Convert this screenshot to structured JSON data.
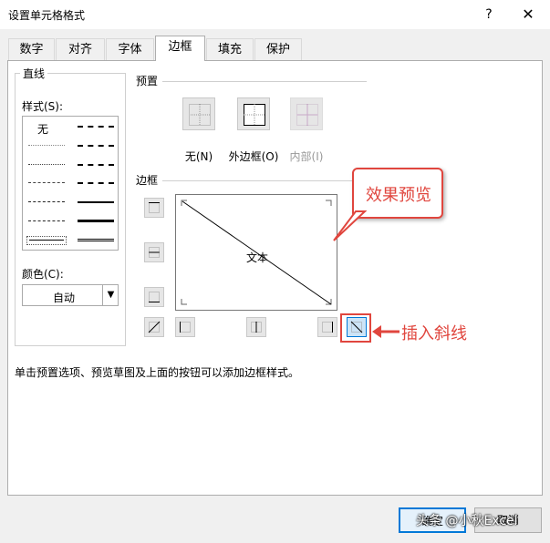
{
  "window": {
    "title": "设置单元格格式",
    "help": "?",
    "close": "✕"
  },
  "tabs": [
    {
      "label": "数字"
    },
    {
      "label": "对齐"
    },
    {
      "label": "字体"
    },
    {
      "label": "边框",
      "active": true
    },
    {
      "label": "填充"
    },
    {
      "label": "保护"
    }
  ],
  "lines": {
    "group_label": "直线",
    "style_label": "样式(S):",
    "none_label": "无",
    "color_label": "颜色(C):",
    "color_value": "自动"
  },
  "presets": {
    "group_label": "预置",
    "items": [
      {
        "label": "无(N)"
      },
      {
        "label": "外边框(O)"
      },
      {
        "label": "内部(I)",
        "disabled": true
      }
    ]
  },
  "border": {
    "group_label": "边框",
    "preview_text": "文本"
  },
  "annotations": {
    "preview_callout": "效果预览",
    "insert_diagonal": "插入斜线"
  },
  "instruction": "单击预置选项、预览草图及上面的按钮可以添加边框样式。",
  "buttons": {
    "ok": "确定",
    "cancel": "取消"
  },
  "watermark": "头条 @小秋Excel",
  "colors": {
    "accent": "#0078d7",
    "annotation_red": "#e0463e"
  }
}
